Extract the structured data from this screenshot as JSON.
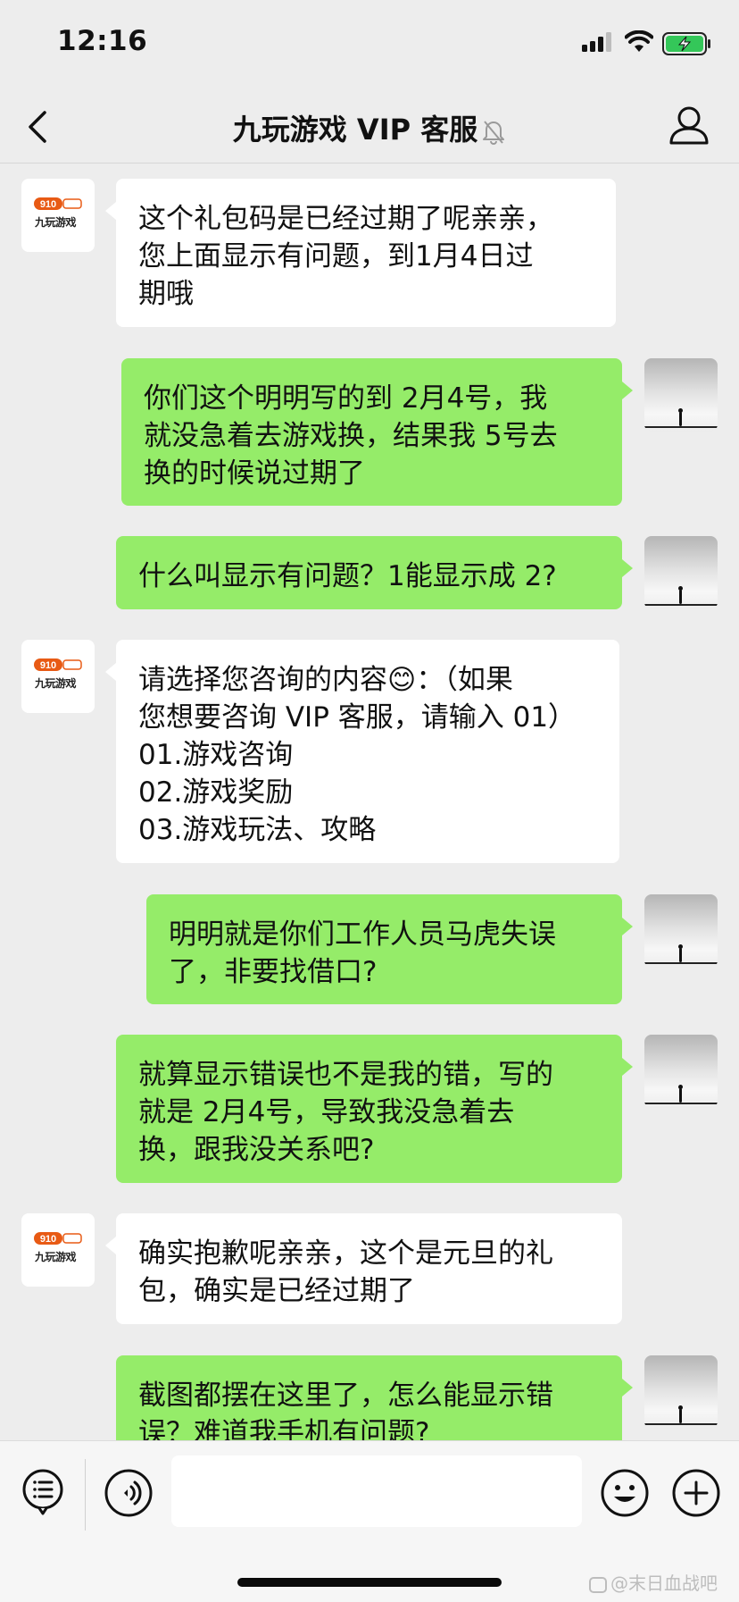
{
  "status_bar": {
    "time": "12:16"
  },
  "nav": {
    "title": "九玩游戏 VIP 客服"
  },
  "bot": {
    "logo_top": "910",
    "logo_text": "九玩游戏"
  },
  "messages": [
    {
      "side": "in",
      "text": "这个礼包码是已经过期了呢亲亲，\n您上面显示有问题，到1月4日过\n期哦"
    },
    {
      "side": "out",
      "text": "你们这个明明写的到 2月4号，我\n就没急着去游戏换，结果我 5号去\n换的时候说过期了"
    },
    {
      "side": "out",
      "text": "什么叫显示有问题？1能显示成 2?"
    },
    {
      "side": "in",
      "text": "请选择您咨询的内容😊：（如果\n您想要咨询 VIP 客服，请输入 01）\n01.游戏咨询\n02.游戏奖励\n03.游戏玩法、攻略"
    },
    {
      "side": "out",
      "text": "明明就是你们工作人员马虎失误\n了，非要找借口?"
    },
    {
      "side": "out",
      "text": "就算显示错误也不是我的错，写的\n就是 2月4号，导致我没急着去\n换，跟我没关系吧?"
    },
    {
      "side": "in",
      "text": "确实抱歉呢亲亲，这个是元旦的礼\n包，确实是已经过期了"
    },
    {
      "side": "out",
      "text": "截图都摆在这里了，怎么能显示错\n误？难道我手机有问题?"
    }
  ],
  "watermark": "@末日血战吧",
  "icons": {
    "back": "chevron-left-icon",
    "mute": "bell-off-icon",
    "profile": "person-icon",
    "menu": "list-menu-icon",
    "voice": "voice-icon",
    "emoji": "emoji-icon",
    "plus": "plus-icon"
  },
  "colors": {
    "outgoing_bubble": "#95ec69",
    "incoming_bubble": "#ffffff",
    "background": "#ededed"
  }
}
